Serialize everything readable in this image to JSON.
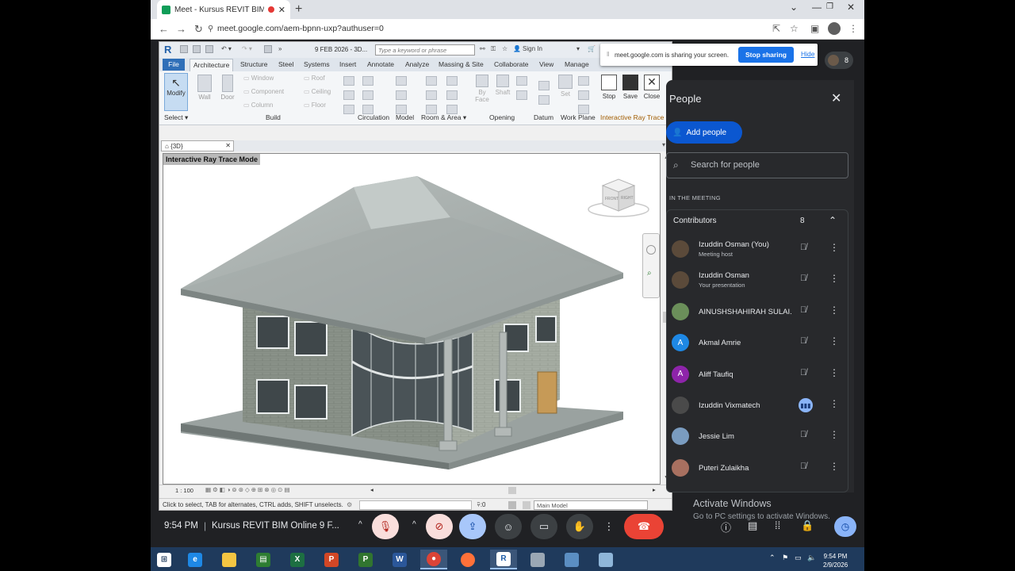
{
  "browser": {
    "tab_title": "Meet - Kursus REVIT BIM Or",
    "url_domain": "meet.google.com",
    "url_path": "/aem-bpnn-uxp?authuser=0"
  },
  "revit": {
    "qat_title": "9 FEB 2026 - 3D...",
    "keyword_placeholder": "Type a keyword or phrase",
    "sign_in": "Sign In",
    "tabs": [
      "File",
      "Architecture",
      "Structure",
      "Steel",
      "Systems",
      "Insert",
      "Annotate",
      "Analyze",
      "Massing & Site",
      "Collaborate",
      "View",
      "Manage"
    ],
    "ribbon": {
      "modify": "Modify",
      "wall": "Wall",
      "door": "Door",
      "build_list": [
        "Window",
        "Component",
        "Column"
      ],
      "roof_list": [
        "Roof",
        "Ceiling",
        "Floor"
      ],
      "by_face": "By Face",
      "shaft": "Shaft",
      "set": "Set",
      "stop": "Stop",
      "save": "Save",
      "close": "Close",
      "groups": [
        "Select",
        "Build",
        "Circulation",
        "Model",
        "Room & Area",
        "Opening",
        "Datum",
        "Work Plane",
        "Interactive Ray Trace"
      ]
    },
    "view_tab": "{3D}",
    "mode_label": "Interactive Ray Trace Mode",
    "viewcube_front": "FRONT",
    "viewcube_right": "RIGHT",
    "scale": "1 : 100",
    "status_text": "Click to select, TAB for alternates, CTRL adds, SHIFT unselects.",
    "status_zero": ":0",
    "main_model": "Main Model"
  },
  "sharebar": {
    "message": "meet.google.com is sharing your screen.",
    "stop": "Stop sharing",
    "hide": "Hide"
  },
  "people_count": "8",
  "panel": {
    "title": "People",
    "add_people": "Add people",
    "search_placeholder": "Search for people",
    "in_meeting": "IN THE MEETING",
    "contributors_label": "Contributors",
    "contributors_count": "8",
    "participants": [
      {
        "name": "Izuddin Osman (You)",
        "sub": "Meeting host",
        "initial": "",
        "color": "#5b4a3a"
      },
      {
        "name": "Izuddin Osman",
        "sub": "Your presentation",
        "initial": "",
        "color": "#5b4a3a"
      },
      {
        "name": "AINUSHSHAHIRAH SULAI...",
        "sub": "",
        "initial": "",
        "color": "#6b8f5a"
      },
      {
        "name": "Akmal Amrie",
        "sub": "",
        "initial": "A",
        "color": "#1e88e5"
      },
      {
        "name": "Aliff Taufiq",
        "sub": "",
        "initial": "A",
        "color": "#8e24aa"
      },
      {
        "name": "Izuddin Vixmatech",
        "sub": "",
        "initial": "",
        "color": "#4a4a4a"
      },
      {
        "name": "Jessie Lim",
        "sub": "",
        "initial": "",
        "color": "#7a9cc0"
      },
      {
        "name": "Puteri Zulaikha",
        "sub": "",
        "initial": "",
        "color": "#a87060"
      }
    ]
  },
  "meet_bar": {
    "time": "9:54 PM",
    "separator": "|",
    "meeting_title": "Kursus REVIT BIM Online 9 F..."
  },
  "windows_activation": {
    "line1": "Activate Windows",
    "line2": "Go to PC settings to activate Windows."
  },
  "taskbar": {
    "time": "9:54 PM",
    "date": "2/9/2026"
  },
  "icons": {
    "colors": {
      "accent": "#1a73e8",
      "end_call": "#ea4335",
      "panel_bg": "#28292c",
      "meet_bg": "#202124"
    }
  }
}
